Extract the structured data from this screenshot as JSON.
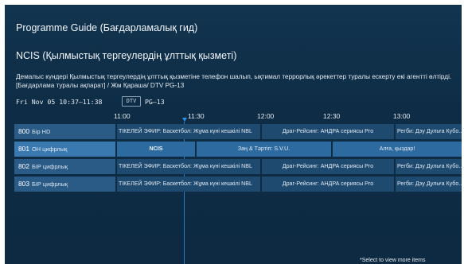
{
  "header": {
    "guide_title": "Programme Guide (Бағдарламалық гид)",
    "programme_title": "NCIS (Қылмыстық тергеулердің ұлттық қызметі)",
    "description_line1": "Демалыс күндері Қылмыстық тергеулердің ұлттық қызметіне телефон шалып, ықтимал террорлық әрекеттер туралы ескерту екі агентті өлтірді.",
    "description_line2": "[Бағдарлама туралы ақпарат] / Жм Қараша/ DTV PG-13",
    "datetime": "Fri Nov 05 10:37–11:38",
    "badge": "DTV",
    "rating": "PG–13"
  },
  "timeline": [
    "11:00",
    "11:30",
    "12:00",
    "12:30",
    "13:00"
  ],
  "channels": [
    {
      "number": "800",
      "name": "Бір HD",
      "programs": [
        "ТІКЕЛЕЙ ЭФИР: Баскетбол: Жұма күні кешкілі NBL",
        "Драг-Рейсинг: АНДРА сериясы Pro",
        "Регби: Дэу Дульға Кубо..."
      ]
    },
    {
      "number": "801",
      "name": "ОН цифрлық",
      "programs": [
        "NCIS",
        "Заң & Тәртіп: S.V.U.",
        "Алға, қыздар!"
      ]
    },
    {
      "number": "802",
      "name": "БІР цифрлық",
      "programs": [
        "ТІКЕЛЕЙ ЭФИР: Баскетбол: Жұма күні кешкілі NBL",
        "Драг-Рейсинг: АНДРА сериясы Pro",
        "Регби: Дэу Дульға Кубо..."
      ]
    },
    {
      "number": "803",
      "name": "БІР цифрлық",
      "programs": [
        "ТІКЕЛЕЙ ЭФИР: Баскетбол: Жұма күні кешкілі NBL",
        "Драг-Рейсинг: АНДРА сериясы Pro",
        "Регби: Дэу Дульға Кубо..."
      ]
    }
  ],
  "footer": {
    "hint": "*Select to view more items"
  },
  "colors": {
    "background": "#0e2c45",
    "channel_cell": "#2a5a86",
    "program_cell": "#1f4a70",
    "selected_row": "#2c6aa0",
    "now_marker": "#2f8fe0"
  },
  "icons": {
    "now_marker": "down-triangle-icon"
  }
}
